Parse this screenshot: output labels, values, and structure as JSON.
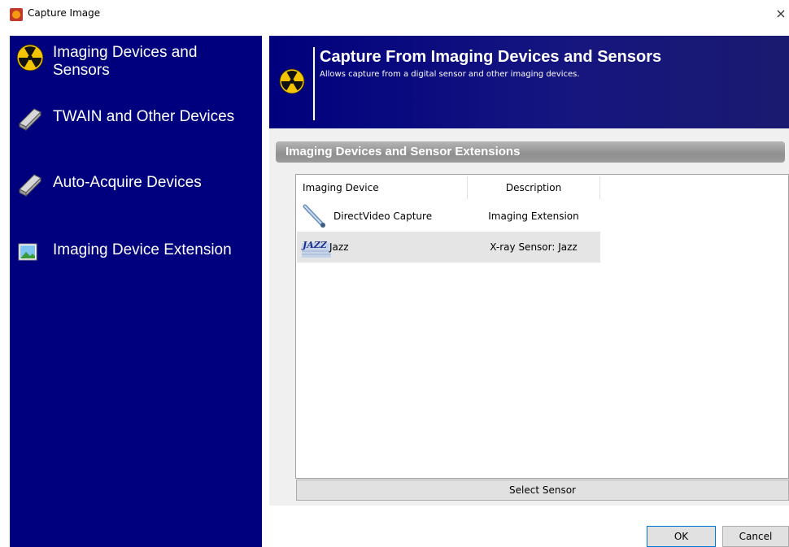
{
  "window": {
    "title": "Capture Image",
    "close_glyph": "×"
  },
  "nav": {
    "items": [
      {
        "label": "Imaging Devices and\nSensors",
        "icon": "radiation-icon"
      },
      {
        "label": "TWAIN and Other Devices",
        "icon": "scanner-icon"
      },
      {
        "label": "Auto-Acquire Devices",
        "icon": "scanner-icon"
      },
      {
        "label": "Imaging Device Extension",
        "icon": "image-icon"
      }
    ]
  },
  "header": {
    "title": "Capture From Imaging Devices and Sensors",
    "subtitle": "Allows capture from a digital sensor and other imaging devices.",
    "icon": "radiation-icon"
  },
  "section": {
    "title": "Imaging Devices and Sensor Extensions"
  },
  "list": {
    "columns": [
      "Imaging Device",
      "Description"
    ],
    "rows": [
      {
        "device": "DirectVideo Capture",
        "description": "Imaging Extension",
        "icon": "camera-probe-icon",
        "selected": false
      },
      {
        "device": "Jazz",
        "description": "X-ray Sensor: Jazz",
        "icon": "jazz-logo-icon",
        "selected": true
      }
    ]
  },
  "buttons": {
    "select_sensor": "Select Sensor",
    "ok": "OK",
    "cancel": "Cancel"
  },
  "colors": {
    "nav_bg": "#00007e",
    "header_bg": "#151580",
    "selected_row": "#e5e5e5",
    "ok_border": "#0078d7"
  }
}
